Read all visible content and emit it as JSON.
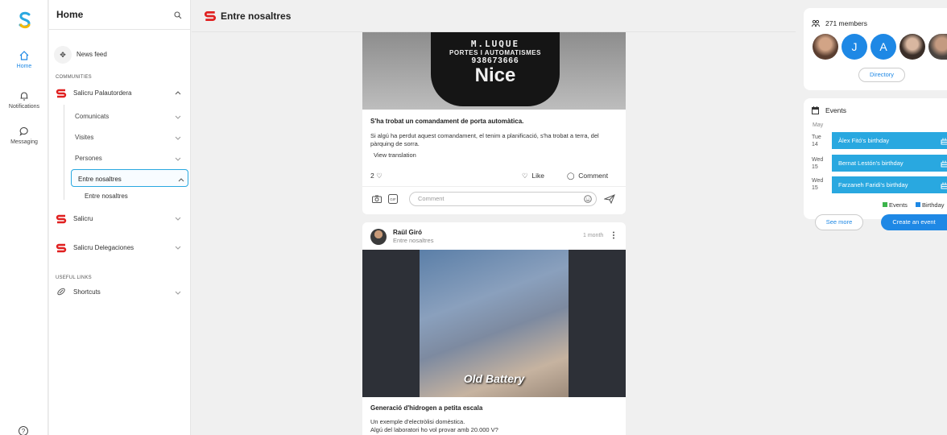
{
  "rail": {
    "items": [
      {
        "label": "Home",
        "icon": "home-icon"
      },
      {
        "label": "Notifications",
        "icon": "bell-icon"
      },
      {
        "label": "Messaging",
        "icon": "chat-icon"
      }
    ]
  },
  "nav": {
    "title": "Home",
    "news_feed": "News feed",
    "communities_label": "COMMUNITIES",
    "communities": [
      {
        "label": "Salicru Palautordera",
        "expanded": true
      },
      {
        "label": "Salicru",
        "expanded": false
      },
      {
        "label": "Salicru Delegaciones",
        "expanded": false
      }
    ],
    "subitems": [
      "Comunicats",
      "Visites",
      "Persones",
      "Entre nosaltres"
    ],
    "active_subitem_child": "Entre nosaltres",
    "useful_links_label": "USEFUL LINKS",
    "shortcuts": "Shortcuts"
  },
  "header": {
    "title": "Entre nosaltres"
  },
  "post1": {
    "image_text": [
      "M.LUQUE",
      "PORTES I AUTOMATISMES",
      "938673666",
      "Nice"
    ],
    "title": "S'ha trobat un comandament de porta automàtica.",
    "body": "Si algú ha perdut aquest comandament, el tenim a planificació, s'ha trobat a terra, del pàrquing de sorra.",
    "translate": "View translation",
    "like_count": "2",
    "like_label": "Like",
    "comment_label": "Comment",
    "comment_placeholder": "Comment"
  },
  "post2": {
    "author": "Raül Giró",
    "community": "Entre nosaltres",
    "time": "1 month",
    "image_caption": "Old Battery",
    "title": "Generació d'hidrogen a petita escala",
    "body_lines": [
      "Un exemple d'electròlisi domèstica.",
      "Algú del laboratori ho vol provar amb 20.000 V?"
    ]
  },
  "members": {
    "count_label": "271 members",
    "avatars": [
      {
        "initial": "",
        "color": "#7a5a48"
      },
      {
        "initial": "J",
        "color": "#1e88e5"
      },
      {
        "initial": "A",
        "color": "#1e88e5"
      },
      {
        "initial": "",
        "color": "#8a7b6d"
      },
      {
        "initial": "",
        "color": "#5a5550"
      }
    ],
    "directory_label": "Directory"
  },
  "events": {
    "title": "Events",
    "month": "May",
    "items": [
      {
        "dow": "Tue",
        "day": "14",
        "label": "Àlex Fitó's birthday"
      },
      {
        "dow": "Wed",
        "day": "15",
        "label": "Bernat Lestón's birthday"
      },
      {
        "dow": "Wed",
        "day": "15",
        "label": "Farzaneh Faridi's birthday"
      }
    ],
    "legend_events": "Events",
    "legend_birthday": "Birthday",
    "see_more": "See more",
    "create_event": "Create an event"
  },
  "colors": {
    "accent": "#1e88e5",
    "brand_red": "#e02020",
    "event_bar": "#29a8e0",
    "events_swatch": "#3cb44b",
    "birthday_swatch": "#1e88e5"
  }
}
